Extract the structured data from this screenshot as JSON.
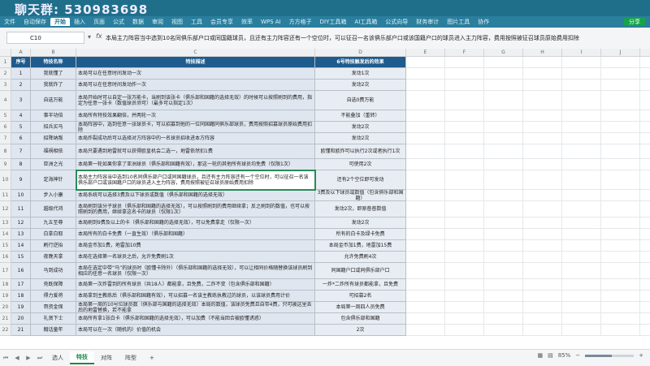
{
  "watermark": "聊天群: 530983698",
  "menu": {
    "file": "文件",
    "autosave": "自动保存",
    "items": [
      "开始",
      "插入",
      "页面",
      "公式",
      "数据",
      "审阅",
      "视图",
      "工具",
      "会员专享",
      "效率",
      "WPS AI",
      "方方格子",
      "DIY工具箱",
      "AI工具箱",
      "公式向导",
      "财务审计",
      "图片工具",
      "协作"
    ],
    "active": "开始",
    "share": "分享"
  },
  "formula_bar": {
    "cell_ref": "C10",
    "fx": "fx",
    "content": "本局主力阵容当中选到10名同俱乐部户口或同国籍球员，且还有主力阵容还有一个空位时，可以征召一名该俱乐部户口或该国籍户口的球员进入主力阵容，费用按照被征召球员原始费用扣除"
  },
  "columns": [
    "A",
    "B",
    "C",
    "D",
    "E",
    "F",
    "G",
    "H",
    "I",
    "J",
    "K",
    "L"
  ],
  "table": {
    "headers": [
      "序号",
      "特技名称",
      "特技描述",
      "6号特技触发后的效果"
    ],
    "rows": [
      {
        "n": "1",
        "name": "我就懂了",
        "desc": "本局可以在任意时间发动一次",
        "effect": "发动1次"
      },
      {
        "n": "2",
        "name": "我就炸了",
        "desc": "本局可以在任意时间发动炸一次",
        "effect": "发动2次"
      },
      {
        "n": "3",
        "name": "自选万能",
        "desc": "本局开始时可以自定一张万能卡，当刷到该张卡（俱乐部和国籍的选择无效）的时候可以按照刷到的费用，指定为任意一张卡（数值球员须可）（最多可以指定1次）",
        "effect": "自选0费万能"
      },
      {
        "n": "4",
        "name": "事半功倍",
        "desc": "本局所有特技效果翻倍，并两轮一次",
        "effect": "不能叠加（重转）"
      },
      {
        "n": "5",
        "name": "招兵买马",
        "desc": "本局阵容中，选到任意一张球员卡，可以招募到他的一位同国籍同俱乐部球员，费用按照招募球员原始费用扣除",
        "effect": "发动2次"
      },
      {
        "n": "6",
        "name": "招降纳叛",
        "desc": "本局炸裂成功后可以选择对方阵容中的一名球员招收进本方阵容",
        "effect": "发动2次"
      },
      {
        "n": "7",
        "name": "福祸相依",
        "desc": "本局只要遇到地雷就可以获得欧皇机会二选一，地雷依然扣1费",
        "effect": "欧懂和欧炸可以执行2次或者执行1次"
      },
      {
        "n": "8",
        "name": "亚洲之光",
        "desc": "本局第一轮如果你拿了亚洲球员（俱乐部和国籍有效），那这一轮的其他所有球员均免费（仅限1次）",
        "effect": "可使用2次"
      },
      {
        "n": "9",
        "name": "定海神针",
        "desc": "本局主力阵容当中选到10名同俱乐部户口或同国籍球员，且还有主力阵容还有一个空位时，可以征召一名该俱乐部户口或该国籍户口的球员进入主力阵容，费用按照被征召球员原始费用扣除",
        "effect": "还有2个空位即可发动"
      },
      {
        "n": "10",
        "name": "步入小康",
        "desc": "本局系统可以选择3费及以下球员或数值（俱乐部和国籍的选择无效）",
        "effect": "3费及以下球员或数值（包含俱乐部和国籍）"
      },
      {
        "n": "11",
        "name": "越级代鸿",
        "desc": "本局刷到该分子球员（俱乐部和国籍的选择无效），可以按照刷到的费用继续拿；反之刷到的数值，也可以按照刷到的费用，继续拿这名卡的球员（仅限1次）",
        "effect": "发动2次，即原普普数值"
      },
      {
        "n": "12",
        "name": "九五至尊",
        "desc": "本局刷到9费及以上的卡（俱乐部和国籍的选择无效），可以免费拿走（仅限一次）",
        "effect": "发动2次"
      },
      {
        "n": "13",
        "name": "白拿白取",
        "desc": "本局所有的白卡免费（一直生效）（俱乐部和国籍）",
        "effect": "所有的白卡及绿卡免费"
      },
      {
        "n": "14",
        "name": "刷行逆抬",
        "desc": "本局金币加1费，地雷加10费",
        "effect": "本局金币加1费，地雷加15费"
      },
      {
        "n": "15",
        "name": "夜晚天拿",
        "desc": "本局在选择第一名球员之后，允许免费刷1次",
        "effect": "允许免费刷4次"
      },
      {
        "n": "16",
        "name": "马到成功",
        "desc": "本局在选定中带“马”的球员时（欧懂卡除外）（俱乐部和国籍的选择无效），可以让相同价格随替换该球员刷到相应的任意一名球员（仅限一次）",
        "effect": "同国籍户口或同俱乐部户口"
      },
      {
        "n": "17",
        "name": "壳既保障",
        "desc": "本局第一次炸雷到的所有球员（共18人）都能拿，且免费，二炸不变（包含俱乐部和国籍）",
        "effect": "一炸*二炸所有球员都能拿，且免费"
      },
      {
        "n": "18",
        "name": "得力爱将",
        "desc": "本局拿到主教练后（俱乐部和国籍有效），可以招募一名该主教练执教过的球员，以该球员费用计价",
        "effect": "可招募2名"
      },
      {
        "n": "19",
        "name": "哥资金保",
        "desc": "本局第一周的10号位球员数（俱乐部与国籍的选择无效）本局的数值，该球员免费且自带4费，只可被这里去后的地雷替换，若不能拿",
        "effect": "本局第一周四人员免费"
      },
      {
        "n": "20",
        "name": "礼贤下士",
        "desc": "本局所有拿1张白卡（俱乐部和国籍的选择无效），可以加费（不能当回合被欧懂诱惑）",
        "effect": "包含俱乐部和国籍"
      },
      {
        "n": "21",
        "name": "翰话童年",
        "desc": "本局可以在一次（随机的）价值的机会",
        "effect": "2次"
      }
    ]
  },
  "tabs": {
    "items": [
      "选人",
      "特技",
      "对阵",
      "阵型"
    ],
    "active": "特技",
    "add": "+"
  },
  "status": {
    "zoom": "85%",
    "zoom_fraction": 0.55
  }
}
